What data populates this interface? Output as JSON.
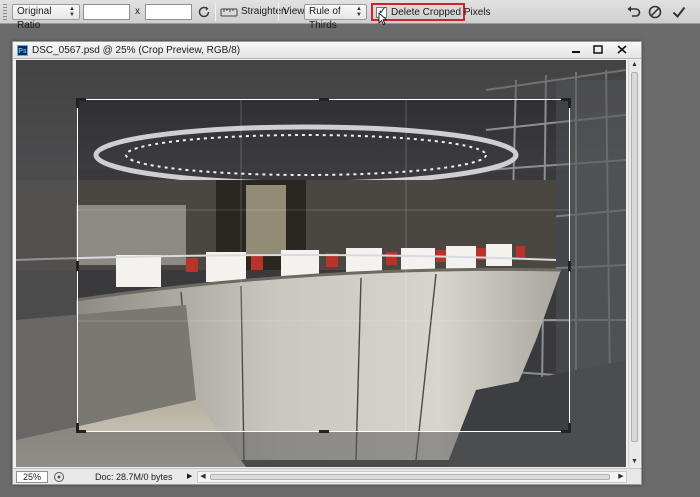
{
  "options_bar": {
    "ratio_select": "Original Ratio",
    "width_value": "",
    "x_separator": "x",
    "height_value": "",
    "straighten_label": "Straighten",
    "view_label": "View:",
    "view_select": "Rule of Thirds",
    "delete_cropped_label": "Delete Cropped Pixels",
    "delete_cropped_checked": true,
    "highlight_color": "#d2232a"
  },
  "document": {
    "title": "DSC_0567.psd @ 25% (Crop Preview, RGB/8)",
    "app_badge": "Ps",
    "zoom": "25%",
    "doc_size": "Doc: 28.7M/0 bytes"
  },
  "icons": {
    "swap": "swap-dimensions-icon",
    "straighten": "straighten-ruler-icon",
    "reset": "reset-icon",
    "cancel": "cancel-icon",
    "commit": "commit-check-icon"
  }
}
